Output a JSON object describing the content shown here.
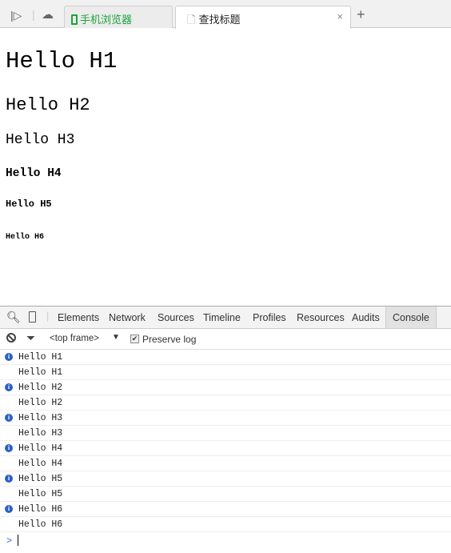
{
  "browser": {
    "tabs": [
      {
        "label": "手机浏览器",
        "color": "#1aa33a"
      },
      {
        "label": "查找标题",
        "active": true
      }
    ],
    "close": "×",
    "new_tab": "+"
  },
  "page": {
    "headings": [
      "Hello H1",
      "Hello H2",
      "Hello H3",
      "Hello H4",
      "Hello H5",
      "Hello H6"
    ]
  },
  "devtools": {
    "tabs": [
      "Elements",
      "Network",
      "Sources",
      "Timeline",
      "Profiles",
      "Resources",
      "Audits",
      "Console"
    ],
    "active_tab": "Console",
    "frame": "<top frame>",
    "preserve_log": "Preserve log",
    "preserve_checked": true,
    "logs": [
      {
        "text": "Hello H1",
        "info": true
      },
      {
        "text": "Hello H1",
        "info": false
      },
      {
        "text": "Hello H2",
        "info": true
      },
      {
        "text": "Hello H2",
        "info": false
      },
      {
        "text": "Hello H3",
        "info": true
      },
      {
        "text": "Hello H3",
        "info": false
      },
      {
        "text": "Hello H4",
        "info": true
      },
      {
        "text": "Hello H4",
        "info": false
      },
      {
        "text": "Hello H5",
        "info": true
      },
      {
        "text": "Hello H5",
        "info": false
      },
      {
        "text": "Hello H6",
        "info": true
      },
      {
        "text": "Hello H6",
        "info": false
      }
    ],
    "prompt": ">"
  }
}
